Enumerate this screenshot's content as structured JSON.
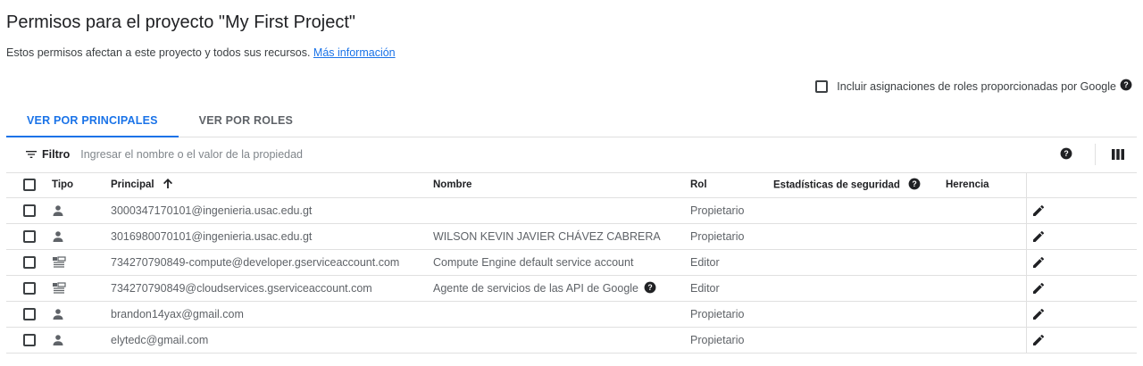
{
  "page": {
    "title": "Permisos para el proyecto \"My First Project\"",
    "subtitle": "Estos permisos afectan a este proyecto y todos sus recursos.",
    "learn_more": "Más información"
  },
  "google_grants": {
    "label": "Incluir asignaciones de roles proporcionadas por Google",
    "checked": false
  },
  "tabs": [
    {
      "label": "VER POR PRINCIPALES",
      "active": true
    },
    {
      "label": "VER POR ROLES",
      "active": false
    }
  ],
  "filter": {
    "label": "Filtro",
    "placeholder": "Ingresar el nombre o el valor de la propiedad"
  },
  "table": {
    "headers": {
      "type": "Tipo",
      "principal": "Principal",
      "name": "Nombre",
      "role": "Rol",
      "stats": "Estadísticas de seguridad",
      "inheritance": "Herencia"
    },
    "rows": [
      {
        "type_icon": "person-icon",
        "principal": "3000347170101@ingenieria.usac.edu.gt",
        "name": "",
        "role": "Propietario"
      },
      {
        "type_icon": "person-icon",
        "principal": "3016980070101@ingenieria.usac.edu.gt",
        "name": "WILSON KEVIN JAVIER CHÁVEZ CABRERA",
        "role": "Propietario"
      },
      {
        "type_icon": "service-account-icon",
        "principal": "734270790849-compute@developer.gserviceaccount.com",
        "name": "Compute Engine default service account",
        "role": "Editor"
      },
      {
        "type_icon": "service-account-icon",
        "principal": "734270790849@cloudservices.gserviceaccount.com",
        "name": "Agente de servicios de las API de Google",
        "role": "Editor",
        "name_help": true
      },
      {
        "type_icon": "person-icon",
        "principal": "brandon14yax@gmail.com",
        "name": "",
        "role": "Propietario"
      },
      {
        "type_icon": "person-icon",
        "principal": "elytedc@gmail.com",
        "name": "",
        "role": "Propietario"
      }
    ]
  },
  "colors": {
    "accent": "#1a73e8",
    "text": "#202124",
    "muted": "#5f6368",
    "divider": "#e0e0e0"
  }
}
